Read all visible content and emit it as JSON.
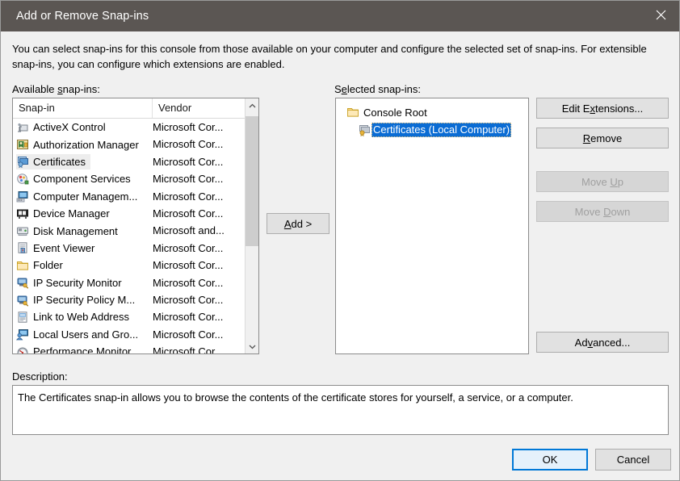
{
  "window": {
    "title": "Add or Remove Snap-ins",
    "close_icon": "close-icon"
  },
  "intro": "You can select snap-ins for this console from those available on your computer and configure the selected set of snap-ins. For extensible snap-ins, you can configure which extensions are enabled.",
  "labels": {
    "available": "Available snap-ins:",
    "selected": "Selected snap-ins:",
    "description": "Description:"
  },
  "available_list": {
    "columns": [
      "Snap-in",
      "Vendor"
    ],
    "rows": [
      {
        "name": "ActiveX Control",
        "vendor": "Microsoft Cor...",
        "icon": "activex-control-icon",
        "selected": false
      },
      {
        "name": "Authorization Manager",
        "vendor": "Microsoft Cor...",
        "icon": "authorization-manager-icon",
        "selected": false
      },
      {
        "name": "Certificates",
        "vendor": "Microsoft Cor...",
        "icon": "certificates-icon",
        "selected": true
      },
      {
        "name": "Component Services",
        "vendor": "Microsoft Cor...",
        "icon": "component-services-icon",
        "selected": false
      },
      {
        "name": "Computer Managem...",
        "vendor": "Microsoft Cor...",
        "icon": "computer-management-icon",
        "selected": false
      },
      {
        "name": "Device Manager",
        "vendor": "Microsoft Cor...",
        "icon": "device-manager-icon",
        "selected": false
      },
      {
        "name": "Disk Management",
        "vendor": "Microsoft and...",
        "icon": "disk-management-icon",
        "selected": false
      },
      {
        "name": "Event Viewer",
        "vendor": "Microsoft Cor...",
        "icon": "event-viewer-icon",
        "selected": false
      },
      {
        "name": "Folder",
        "vendor": "Microsoft Cor...",
        "icon": "folder-icon",
        "selected": false
      },
      {
        "name": "IP Security Monitor",
        "vendor": "Microsoft Cor...",
        "icon": "ip-security-monitor-icon",
        "selected": false
      },
      {
        "name": "IP Security Policy M...",
        "vendor": "Microsoft Cor...",
        "icon": "ip-security-policy-icon",
        "selected": false
      },
      {
        "name": "Link to Web Address",
        "vendor": "Microsoft Cor...",
        "icon": "link-to-web-address-icon",
        "selected": false
      },
      {
        "name": "Local Users and Gro...",
        "vendor": "Microsoft Cor...",
        "icon": "local-users-groups-icon",
        "selected": false
      },
      {
        "name": "Performance Monitor",
        "vendor": "Microsoft Cor...",
        "icon": "performance-monitor-icon",
        "selected": false
      }
    ],
    "scrollbar": {
      "up_arrow": "chevron-up-icon",
      "down_arrow": "chevron-down-icon"
    }
  },
  "selected_tree": {
    "root": {
      "label": "Console Root",
      "icon": "folder-icon"
    },
    "child": {
      "label": "Certificates (Local Computer)",
      "icon": "certificates-icon",
      "highlighted": true
    }
  },
  "buttons": {
    "add": {
      "label": "Add >",
      "accel": "A",
      "enabled": true
    },
    "edit_extensions": {
      "label": "Edit Extensions...",
      "accel": "x",
      "enabled": true
    },
    "remove": {
      "label": "Remove",
      "accel": "R",
      "enabled": true
    },
    "move_up": {
      "label": "Move Up",
      "accel": "U",
      "enabled": false
    },
    "move_down": {
      "label": "Move Down",
      "accel": "D",
      "enabled": false
    },
    "advanced": {
      "label": "Advanced...",
      "accel": "v",
      "enabled": true
    },
    "ok": {
      "label": "OK",
      "enabled": true,
      "default": true
    },
    "cancel": {
      "label": "Cancel",
      "enabled": true
    }
  },
  "description": "The Certificates snap-in allows you to browse the contents of the certificate stores for yourself, a service, or a computer.",
  "colors": {
    "titlebar": "#5b5653",
    "dialog_bg": "#f0f0f0",
    "selection_blue": "#0a6cd4",
    "focus_blue": "#0078d7",
    "default_button_fill": "#e5f1fb"
  }
}
